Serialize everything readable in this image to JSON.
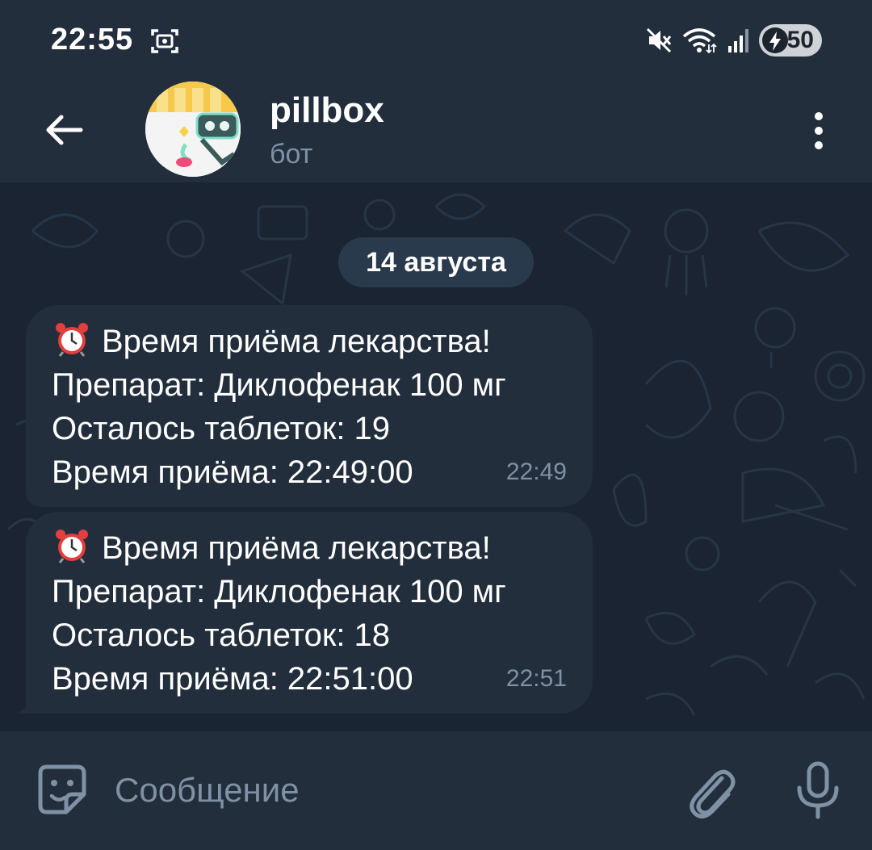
{
  "status_bar": {
    "time": "22:55",
    "battery_level": "50",
    "icons": [
      "screenshot-icon",
      "mute-icon",
      "wifi-icon",
      "signal-icon",
      "battery-charging-icon"
    ]
  },
  "header": {
    "chat_name": "pillbox",
    "chat_subtitle": "бот",
    "icons": [
      "back-arrow-icon",
      "bot-avatar",
      "more-vertical-icon"
    ]
  },
  "chat": {
    "date_label": "14 августа",
    "messages": [
      {
        "emoji": "alarm-clock-icon",
        "title": "Время приёма лекарства!",
        "drug": "Препарат: Диклофенак 100 мг",
        "remaining": "Осталось таблеток: 19",
        "intake_time": "Время приёма: 22:49:00",
        "time": "22:49"
      },
      {
        "emoji": "alarm-clock-icon",
        "title": "Время приёма лекарства!",
        "drug": "Препарат: Диклофенак 100 мг",
        "remaining": "Осталось таблеток: 18",
        "intake_time": "Время приёма: 22:51:00",
        "time": "22:51"
      }
    ]
  },
  "composer": {
    "placeholder": "Сообщение",
    "icons": [
      "sticker-icon",
      "paperclip-icon",
      "microphone-icon"
    ]
  },
  "colors": {
    "header_bg": "#232e3c",
    "chat_bg": "#1a2433",
    "bubble_bg": "#222e3c",
    "secondary_text": "#7f91a4",
    "date_pill_bg": "#2a3a4d"
  }
}
